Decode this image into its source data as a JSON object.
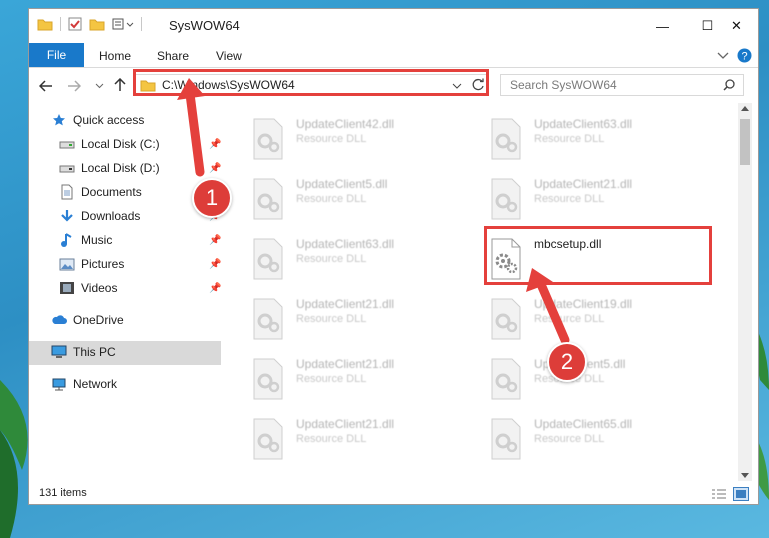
{
  "window": {
    "title": "SysWOW64",
    "minimize_glyph": "—",
    "maximize_glyph": "☐",
    "close_glyph": "✕"
  },
  "ribbon": {
    "file_tab": "File",
    "tabs": [
      "Home",
      "Share",
      "View"
    ]
  },
  "address_bar": {
    "path": "C:\\Windows\\SysWOW64"
  },
  "search": {
    "placeholder": "Search SysWOW64"
  },
  "sidebar": {
    "items": [
      {
        "label": "Quick access",
        "icon": "star-icon",
        "pinned": false
      },
      {
        "label": "Local Disk (C:)",
        "icon": "drive-icon",
        "pinned": true
      },
      {
        "label": "Local Disk (D:)",
        "icon": "drive-icon",
        "pinned": true
      },
      {
        "label": "Documents",
        "icon": "documents-icon",
        "pinned": true
      },
      {
        "label": "Downloads",
        "icon": "download-icon",
        "pinned": true
      },
      {
        "label": "Music",
        "icon": "music-icon",
        "pinned": true
      },
      {
        "label": "Pictures",
        "icon": "pictures-icon",
        "pinned": true
      },
      {
        "label": "Videos",
        "icon": "videos-icon",
        "pinned": true
      },
      {
        "label": "OneDrive",
        "icon": "cloud-icon",
        "pinned": false
      },
      {
        "label": "This PC",
        "icon": "computer-icon",
        "pinned": false,
        "selected": true
      },
      {
        "label": "Network",
        "icon": "network-icon",
        "pinned": false
      }
    ]
  },
  "files": {
    "left_column": [
      {
        "name": "UpdateClient42.dll",
        "type": "Resource DLL"
      },
      {
        "name": "UpdateClient5.dll",
        "type": "Resource DLL"
      },
      {
        "name": "UpdateClient63.dll",
        "type": "Resource DLL"
      },
      {
        "name": "UpdateClient21.dll",
        "type": "Resource DLL"
      },
      {
        "name": "UpdateClient21.dll",
        "type": "Resource DLL"
      },
      {
        "name": "UpdateClient21.dll",
        "type": "Resource DLL"
      }
    ],
    "right_column": [
      {
        "name": "UpdateClient63.dll",
        "type": "Resource DLL"
      },
      {
        "name": "UpdateClient21.dll",
        "type": "Resource DLL"
      },
      {
        "name": "mbcsetup.dll",
        "type": ""
      },
      {
        "name": "UpdateClient19.dll",
        "type": "Resource DLL"
      },
      {
        "name": "UpdateClient5.dll",
        "type": "Resource DLL"
      },
      {
        "name": "UpdateClient65.dll",
        "type": "Resource DLL"
      }
    ]
  },
  "status": {
    "item_count": "131 items"
  },
  "annotations": {
    "step1": "1",
    "step2": "2"
  },
  "colors": {
    "accent": "#1979ca",
    "highlight": "#e4403c"
  }
}
